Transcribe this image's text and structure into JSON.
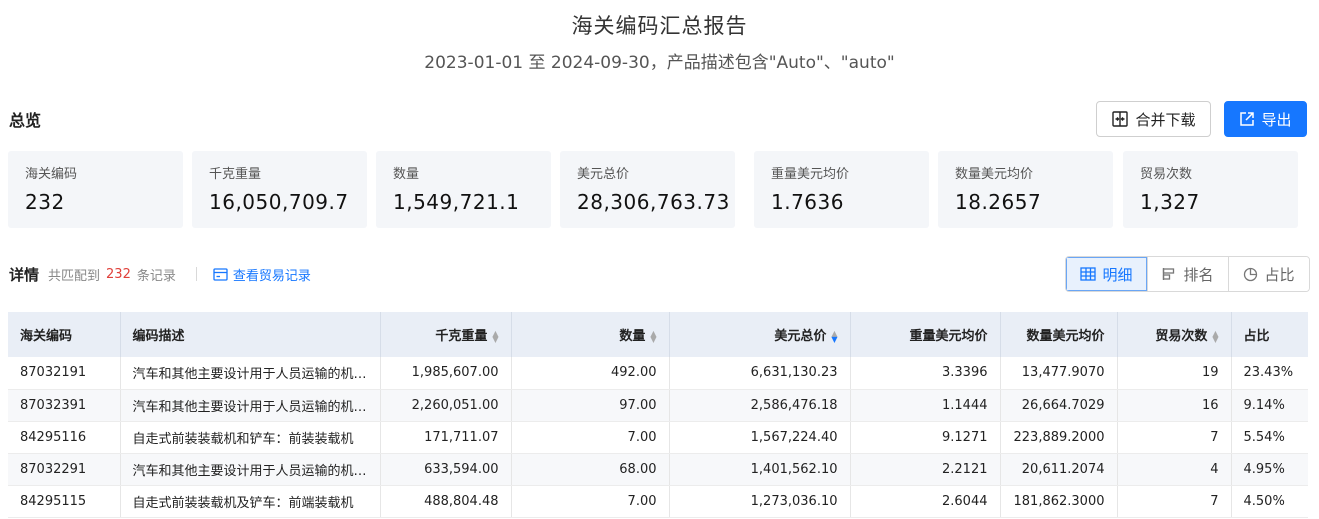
{
  "report": {
    "title": "海关编码汇总报告",
    "subtitle": "2023-01-01 至 2024-09-30，产品描述包含\"Auto\"、\"auto\""
  },
  "overview": {
    "title": "总览",
    "merge_download_label": "合并下载",
    "export_label": "导出",
    "stats": [
      {
        "label": "海关编码",
        "value": "232"
      },
      {
        "label": "千克重量",
        "value": "16,050,709.7"
      },
      {
        "label": "数量",
        "value": "1,549,721.1"
      },
      {
        "label": "美元总价",
        "value": "28,306,763.73"
      },
      {
        "label": "重量美元均价",
        "value": "1.7636"
      },
      {
        "label": "数量美元均价",
        "value": "18.2657"
      },
      {
        "label": "贸易次数",
        "value": "1,327"
      }
    ]
  },
  "details": {
    "title": "详情",
    "matched_prefix": "共匹配到",
    "matched_count": "232",
    "matched_suffix": "条记录",
    "view_trade_label": "查看贸易记录",
    "views": [
      "明细",
      "排名",
      "占比"
    ],
    "active_view": "明细"
  },
  "table": {
    "columns": [
      "海关编码",
      "编码描述",
      "千克重量",
      "数量",
      "美元总价",
      "重量美元均价",
      "数量美元均价",
      "贸易次数",
      "占比"
    ],
    "rows": [
      [
        "87032191",
        "汽车和其他主要设计用于人员运输的机动车辆",
        "1,985,607.00",
        "492.00",
        "6,631,130.23",
        "3.3396",
        "13,477.9070",
        "19",
        "23.43%"
      ],
      [
        "87032391",
        "汽车和其他主要设计用于人员运输的机动车辆",
        "2,260,051.00",
        "97.00",
        "2,586,476.18",
        "1.1444",
        "26,664.7029",
        "16",
        "9.14%"
      ],
      [
        "84295116",
        "自走式前装装载机和铲车：前装装载机",
        "171,711.07",
        "7.00",
        "1,567,224.40",
        "9.1271",
        "223,889.2000",
        "7",
        "5.54%"
      ],
      [
        "87032291",
        "汽车和其他主要设计用于人员运输的机动车辆",
        "633,594.00",
        "68.00",
        "1,401,562.10",
        "2.2121",
        "20,611.2074",
        "4",
        "4.95%"
      ],
      [
        "84295115",
        "自走式前装装载机及铲车：前端装载机",
        "488,804.48",
        "7.00",
        "1,273,036.10",
        "2.6044",
        "181,862.3000",
        "7",
        "4.50%"
      ]
    ]
  }
}
